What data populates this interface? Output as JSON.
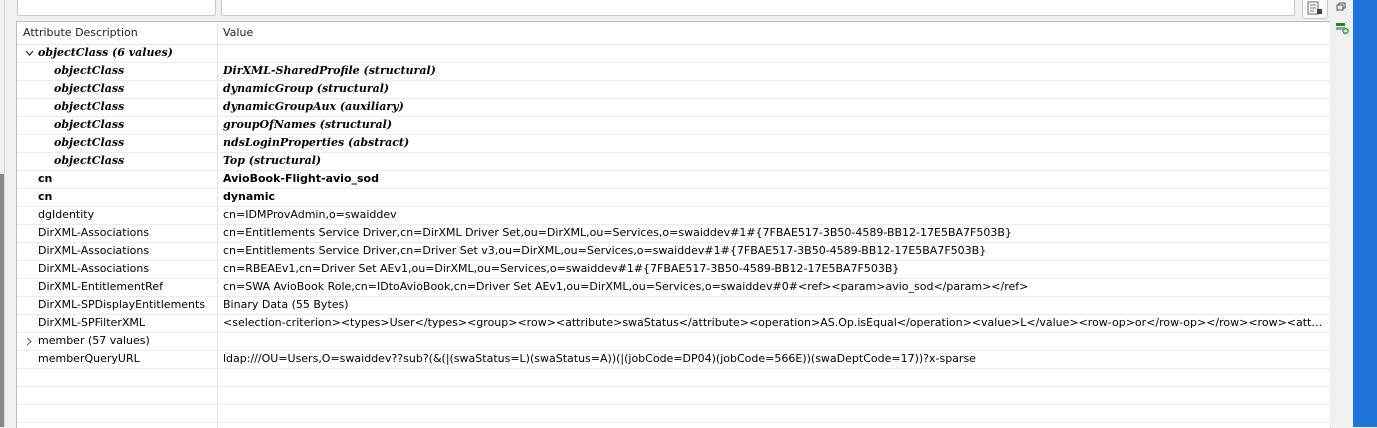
{
  "table": {
    "headers": {
      "attribute": "Attribute Description",
      "value": "Value"
    },
    "rows": [
      {
        "name": "objectClass (6 values)",
        "value": "",
        "style": "bi",
        "level": 0,
        "expander": "expanded"
      },
      {
        "name": "objectClass",
        "value": "DirXML-SharedProfile (structural)",
        "style": "bi",
        "level": 1
      },
      {
        "name": "objectClass",
        "value": "dynamicGroup (structural)",
        "style": "bi",
        "level": 1
      },
      {
        "name": "objectClass",
        "value": "dynamicGroupAux (auxiliary)",
        "style": "bi",
        "level": 1
      },
      {
        "name": "objectClass",
        "value": "groupOfNames (structural)",
        "style": "bi",
        "level": 1
      },
      {
        "name": "objectClass",
        "value": "ndsLoginProperties (abstract)",
        "style": "bi",
        "level": 1
      },
      {
        "name": "objectClass",
        "value": "Top (structural)",
        "style": "bi",
        "level": 1
      },
      {
        "name": "cn",
        "value": "AvioBook-Flight-avio_sod",
        "style": "b",
        "level": 0
      },
      {
        "name": "cn",
        "value": "dynamic",
        "style": "b",
        "level": 0
      },
      {
        "name": "dgIdentity",
        "value": "cn=IDMProvAdmin,o=swaiddev",
        "style": "n",
        "level": 0
      },
      {
        "name": "DirXML-Associations",
        "value": "cn=Entitlements Service Driver,cn=DirXML Driver Set,ou=DirXML,ou=Services,o=swaiddev#1#{7FBAE517-3B50-4589-BB12-17E5BA7F503B}",
        "style": "n",
        "level": 0
      },
      {
        "name": "DirXML-Associations",
        "value": "cn=Entitlements Service Driver,cn=Driver Set v3,ou=DirXML,ou=Services,o=swaiddev#1#{7FBAE517-3B50-4589-BB12-17E5BA7F503B}",
        "style": "n",
        "level": 0
      },
      {
        "name": "DirXML-Associations",
        "value": "cn=RBEAEv1,cn=Driver Set AEv1,ou=DirXML,ou=Services,o=swaiddev#1#{7FBAE517-3B50-4589-BB12-17E5BA7F503B}",
        "style": "n",
        "level": 0
      },
      {
        "name": "DirXML-EntitlementRef",
        "value": "cn=SWA AvioBook Role,cn=IDtoAvioBook,cn=Driver Set AEv1,ou=DirXML,ou=Services,o=swaiddev#0#<ref><param>avio_sod</param></ref>",
        "style": "n",
        "level": 0
      },
      {
        "name": "DirXML-SPDisplayEntitlements",
        "value": "Binary Data (55 Bytes)",
        "style": "n",
        "level": 0
      },
      {
        "name": "DirXML-SPFilterXML",
        "value": "<selection-criterion><types>User</types><group><row><attribute>swaStatus</attribute><operation>AS.Op.isEqual</operation><value>L</value><row-op>or</row-op></row><row><attribute>swa...",
        "style": "n",
        "level": 0
      },
      {
        "name": "member (57 values)",
        "value": "",
        "style": "n",
        "level": 0,
        "expander": "collapsed"
      },
      {
        "name": "memberQueryURL",
        "value": "ldap:///OU=Users,O=swaiddev??sub?(&(|(swaStatus=L)(swaStatus=A))(|(jobCode=DP04)(jobCode=566E))(swaDeptCode=17))?x-sparse",
        "style": "n",
        "level": 0
      }
    ],
    "empty_rows": 3
  },
  "icons": {
    "top_right_button": "properties-icon",
    "restore": "restore-window-icon",
    "add_attribute": "add-attribute-icon"
  },
  "colors": {
    "blue_bar": "#1e74d8",
    "add_icon": "#2ea043"
  }
}
